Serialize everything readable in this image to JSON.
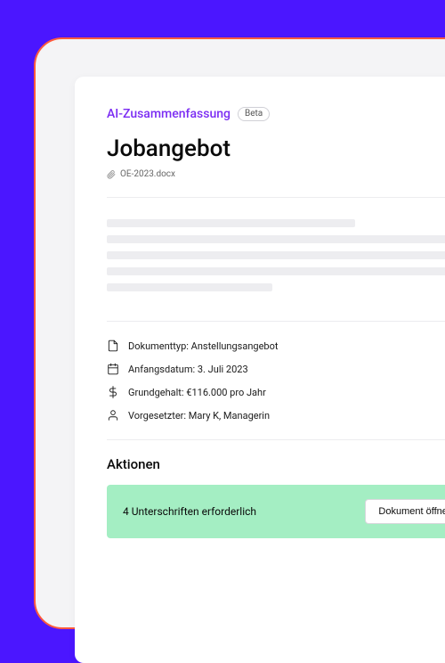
{
  "header": {
    "ai_title": "AI-Zusammenfassung",
    "beta_label": "Beta"
  },
  "document": {
    "title": "Jobangebot",
    "file_name": "OE-2023.docx"
  },
  "meta": {
    "type": "Dokumenttyp: Anstellungsangebot",
    "start_date": "Anfangsdatum: 3. Juli 2023",
    "salary": "Grundgehalt: €116.000 pro Jahr",
    "supervisor": "Vorgesetzter: Mary K, Managerin"
  },
  "actions": {
    "section_title": "Aktionen",
    "banner_text": "4 Unterschriften erforderlich",
    "open_button": "Dokument öffnen"
  },
  "colors": {
    "background": "#4b16ff",
    "frame_border": "#ff5a3d",
    "accent": "#7b2cf3",
    "banner": "#a4eec3"
  }
}
